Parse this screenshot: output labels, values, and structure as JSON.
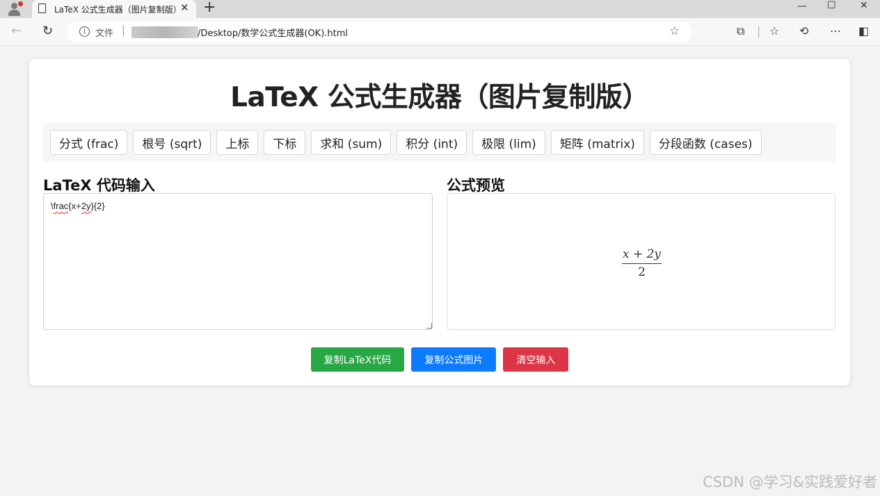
{
  "browser": {
    "tab_title": "LaTeX 公式生成器（图片复制版）",
    "tab_close": "✕",
    "new_tab": "+",
    "window_controls": [
      "—",
      "☐",
      "✕"
    ],
    "url_scheme_label": "文件",
    "url_separator": "|",
    "url_path": "/Desktop/数学公式生成器(OK).html",
    "icons": [
      "back-icon",
      "refresh-icon",
      "info-icon",
      "star-icon",
      "extensions-icon",
      "favorites-icon",
      "history-icon",
      "more-icon",
      "sidebar-icon"
    ]
  },
  "page": {
    "title": "LaTeX 公式生成器（图片复制版）",
    "toolbar": [
      "分式 (frac)",
      "根号 (sqrt)",
      "上标",
      "下标",
      "求和 (sum)",
      "积分 (int)",
      "极限 (lim)",
      "矩阵 (matrix)",
      "分段函数 (cases)"
    ],
    "input_heading": "LaTeX 代码输入",
    "input_value": {
      "prefix": "\\",
      "wavy1": "frac",
      "mid": "{x+",
      "wavy2": "2y",
      "suffix": "}{2}"
    },
    "preview_heading": "公式预览",
    "preview_formula": {
      "numerator_a": "x",
      "numerator_op": " + ",
      "numerator_b": "2y",
      "denominator": "2"
    },
    "buttons": {
      "copy_latex": "复制LaTeX代码",
      "copy_image": "复制公式图片",
      "clear": "清空输入"
    },
    "colors": {
      "copy_latex": "#28a745",
      "copy_image": "#0d7bff",
      "clear": "#dc3545",
      "background": "#f3f3f3"
    }
  },
  "watermark": "CSDN @学习&实践爱好者"
}
